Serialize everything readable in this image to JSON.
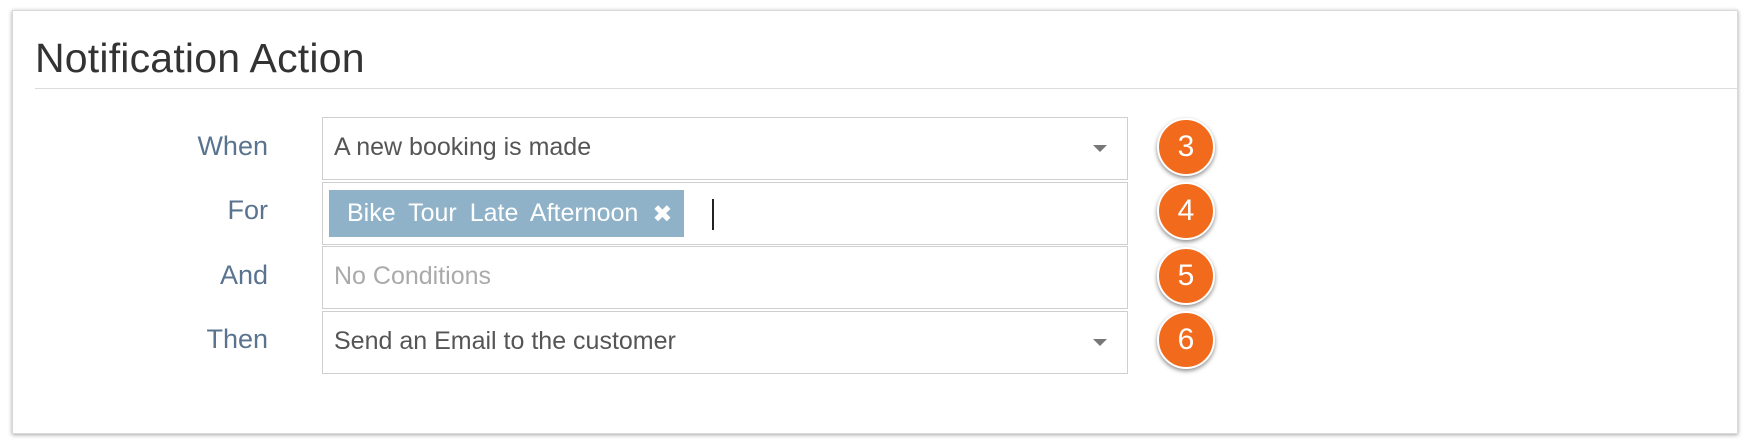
{
  "panel": {
    "title": "Notification Action"
  },
  "rows": {
    "when": {
      "label": "When",
      "value": "A new booking is made",
      "badge": "3"
    },
    "for": {
      "label": "For",
      "tag": "Bike Tour  Late Afternoon",
      "tag_remove": "✖",
      "badge": "4"
    },
    "and": {
      "label": "And",
      "placeholder": "No Conditions",
      "badge": "5"
    },
    "then": {
      "label": "Then",
      "value": "Send an Email to the customer",
      "badge": "6"
    }
  },
  "colors": {
    "label": "#5a7490",
    "tag_background": "#8fb2c9",
    "badge": "#f26a1b"
  },
  "icons": {
    "dropdown": "chevron-down-icon",
    "tag_remove": "close-icon"
  }
}
